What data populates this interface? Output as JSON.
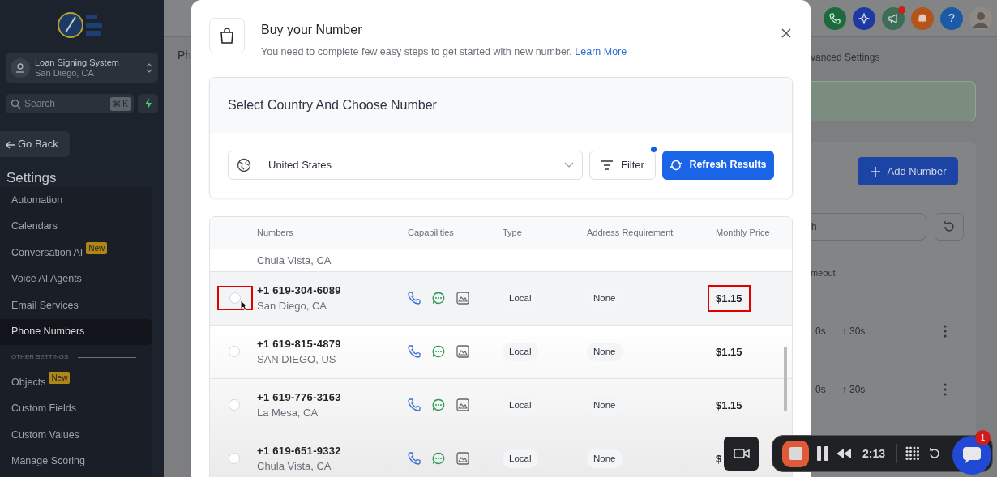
{
  "sidebar": {
    "location": {
      "name": "Loan Signing System",
      "address": "San Diego, CA"
    },
    "search": {
      "placeholder": "Search",
      "shortcut": "⌘ K"
    },
    "back_button": "Go Back",
    "heading": "Settings",
    "items": [
      {
        "kind": "link",
        "label": "Automation",
        "selected": false
      },
      {
        "kind": "link",
        "label": "Calendars",
        "selected": false
      },
      {
        "kind": "link",
        "label": "Conversation AI",
        "badge": "New",
        "selected": false
      },
      {
        "kind": "link",
        "label": "Voice AI Agents",
        "selected": false
      },
      {
        "kind": "link",
        "label": "Email Services",
        "selected": false
      },
      {
        "kind": "link",
        "label": "Phone Numbers",
        "selected": true
      },
      {
        "kind": "section",
        "label": "OTHER SETTINGS"
      },
      {
        "kind": "link",
        "label": "Objects",
        "badge": "New",
        "selected": false
      },
      {
        "kind": "link",
        "label": "Custom Fields",
        "selected": false
      },
      {
        "kind": "link",
        "label": "Custom Values",
        "selected": false
      },
      {
        "kind": "link",
        "label": "Manage Scoring",
        "selected": false
      }
    ]
  },
  "header": {
    "help": "?",
    "megaphone_alert": true
  },
  "page": {
    "title": "Ph",
    "tab": "vanced Settings",
    "add_button": "Add Number",
    "search": {
      "placeholder": "h"
    },
    "column": "meout",
    "rows": [
      {
        "chips": [
          "0s",
          "↑ 30s"
        ]
      },
      {
        "chips": [
          "0s",
          "↑ 30s"
        ]
      }
    ]
  },
  "modal": {
    "title": "Buy your Number",
    "subtitle": "You need to complete few easy steps to get started with new number.",
    "link": "Learn More",
    "section_title": "Select Country And Choose Number",
    "country": "United States",
    "filter_button": "Filter",
    "filter_active": true,
    "refresh_button": "Refresh Results",
    "columns": [
      "Numbers",
      "Capabilities",
      "Type",
      "Address Requirement",
      "Monthly Price"
    ],
    "rows": [
      {
        "kind": "partial",
        "location": "Chula Vista, CA"
      },
      {
        "kind": "full",
        "number": "+1 619-304-6089",
        "location": "San Diego, CA",
        "type": "Local",
        "address": "None",
        "price": "$1.15",
        "selected": false,
        "hovered": true,
        "highlighted": true
      },
      {
        "kind": "full",
        "number": "+1 619-815-4879",
        "location": "SAN DIEGO, US",
        "type": "Local",
        "address": "None",
        "price": "$1.15",
        "selected": false
      },
      {
        "kind": "full",
        "number": "+1 619-776-3163",
        "location": "La Mesa, CA",
        "type": "Local",
        "address": "None",
        "price": "$1.15",
        "selected": false
      },
      {
        "kind": "full",
        "number": "+1 619-651-9332",
        "location": "Chula Vista, CA",
        "type": "Local",
        "address": "None",
        "price": "$",
        "selected": false
      }
    ]
  },
  "recorder": {
    "time": "2:13",
    "badge": "1"
  }
}
